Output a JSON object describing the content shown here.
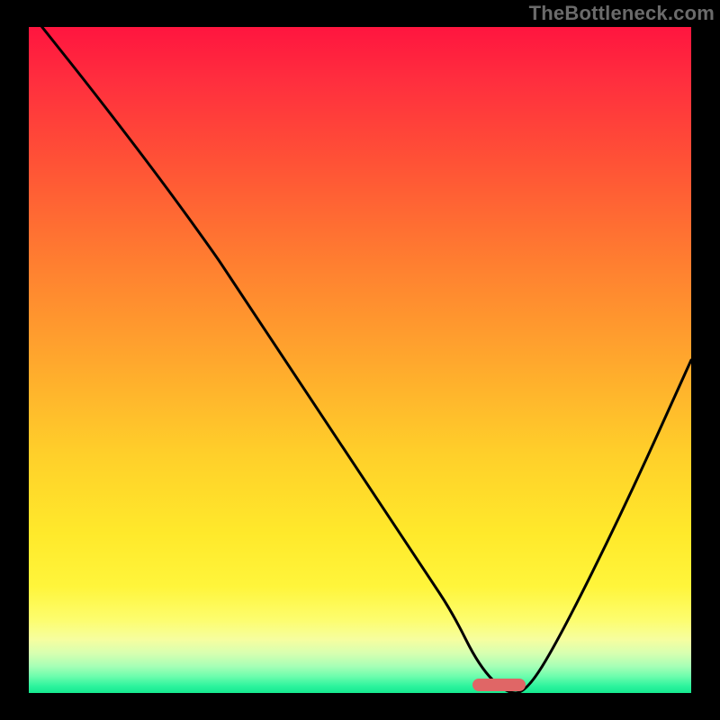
{
  "watermark": "TheBottleneck.com",
  "chart_data": {
    "type": "line",
    "title": "",
    "xlabel": "",
    "ylabel": "",
    "xlim": [
      0,
      100
    ],
    "ylim": [
      0,
      100
    ],
    "series": [
      {
        "name": "curve",
        "x": [
          2,
          10,
          20,
          28,
          30,
          40,
          50,
          60,
          64,
          68,
          72,
          75,
          80,
          90,
          100
        ],
        "values": [
          100,
          90,
          77,
          66,
          63,
          48,
          33,
          18,
          12,
          4,
          0,
          0,
          8,
          28,
          50
        ]
      }
    ],
    "grid": false,
    "legend": false,
    "marker": {
      "x_start": 67,
      "x_end": 75,
      "y": 1
    }
  },
  "colors": {
    "background": "#000000",
    "curve": "#000000",
    "marker": "#e06666",
    "gradient_top": "#ff153f",
    "gradient_bottom": "#16e98f"
  }
}
